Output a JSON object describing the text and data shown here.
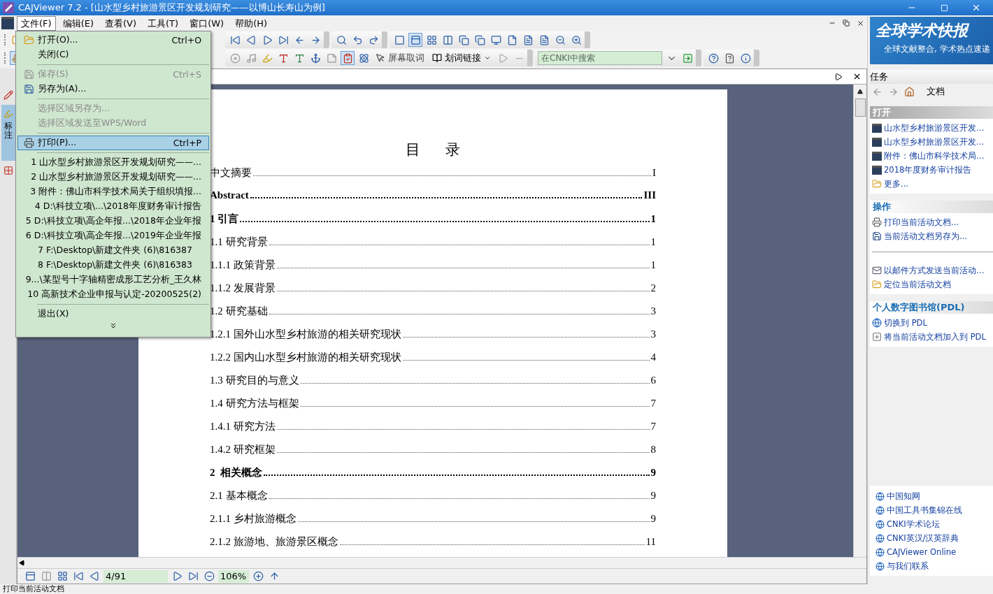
{
  "window": {
    "title": "CAJViewer 7.2 - [山水型乡村旅游景区开发规划研究——以博山长寿山为例]"
  },
  "menu_bar": [
    {
      "label": "文件(F)",
      "selected": true
    },
    {
      "label": "编辑(E)",
      "selected": false
    },
    {
      "label": "查看(V)",
      "selected": false
    },
    {
      "label": "工具(T)",
      "selected": false
    },
    {
      "label": "窗口(W)",
      "selected": false
    },
    {
      "label": "帮助(H)",
      "selected": false
    }
  ],
  "file_menu": [
    {
      "kind": "command",
      "label": "打开(O)...",
      "shortcut": "Ctrl+O",
      "disabled": false,
      "selected": false
    },
    {
      "kind": "command",
      "label": "关闭(C)",
      "disabled": false,
      "selected": false
    },
    {
      "kind": "separator"
    },
    {
      "kind": "command",
      "label": "保存(S)",
      "shortcut": "Ctrl+S",
      "disabled": true,
      "selected": false
    },
    {
      "kind": "command",
      "label": "另存为(A)...",
      "disabled": false,
      "selected": false
    },
    {
      "kind": "separator"
    },
    {
      "kind": "command",
      "label": "选择区域另存为...",
      "disabled": true,
      "selected": false
    },
    {
      "kind": "command",
      "label": "选择区域发送至WPS/Word",
      "disabled": true,
      "selected": false
    },
    {
      "kind": "separator"
    },
    {
      "kind": "command",
      "label": "打印(P)...",
      "shortcut": "Ctrl+P",
      "disabled": false,
      "selected": true
    },
    {
      "kind": "separator"
    },
    {
      "kind": "command",
      "label": "1 山水型乡村旅游景区开发规划研究——...",
      "disabled": false,
      "selected": false
    },
    {
      "kind": "command",
      "label": "2 山水型乡村旅游景区开发规划研究——...",
      "disabled": false,
      "selected": false
    },
    {
      "kind": "command",
      "label": "3 附件：佛山市科学技术局关于组织填报...",
      "disabled": false,
      "selected": false
    },
    {
      "kind": "command",
      "label": "4 D:\\科技立项\\...\\2018年度财务审计报告",
      "disabled": false,
      "selected": false
    },
    {
      "kind": "command",
      "label": "5 D:\\科技立项\\高企年报...\\2018年企业年报",
      "disabled": false,
      "selected": false
    },
    {
      "kind": "command",
      "label": "6 D:\\科技立项\\高企年报...\\2019年企业年报",
      "disabled": false,
      "selected": false
    },
    {
      "kind": "command",
      "label": "7 F:\\Desktop\\新建文件夹 (6)\\816387",
      "disabled": false,
      "selected": false
    },
    {
      "kind": "command",
      "label": "8 F:\\Desktop\\新建文件夹 (6)\\816383",
      "disabled": false,
      "selected": false
    },
    {
      "kind": "command",
      "label": "9...\\某型号十字轴精密成形工艺分析_王久林",
      "disabled": false,
      "selected": false
    },
    {
      "kind": "command",
      "label": "10 高新技术企业申报与认定-20200525(2)",
      "disabled": false,
      "selected": false
    },
    {
      "kind": "separator"
    },
    {
      "kind": "command",
      "label": "退出(X)",
      "disabled": false,
      "selected": false
    },
    {
      "kind": "more"
    }
  ],
  "toolbar": {
    "screen_word_button": "屏幕取词",
    "link_button": "划词链接",
    "search": {
      "placeholder": "在CNKI中搜索"
    }
  },
  "side_tab": {
    "label": "标注"
  },
  "document": {
    "title": "目 录",
    "entries": [
      {
        "label": "中文摘要",
        "page": "I",
        "bold": false
      },
      {
        "label": "Abstract",
        "page": "III",
        "bold": true
      },
      {
        "label": "1 引言",
        "page": "1",
        "bold": true
      },
      {
        "label": "1.1 研究背景",
        "page": "1",
        "bold": false
      },
      {
        "label": "1.1.1 政策背景",
        "page": "1",
        "bold": false
      },
      {
        "label": "1.1.2 发展背景",
        "page": "2",
        "bold": false
      },
      {
        "label": "1.2 研究基础",
        "page": "3",
        "bold": false
      },
      {
        "label": "1.2.1 国外山水型乡村旅游的相关研究现状",
        "page": "3",
        "bold": false
      },
      {
        "label": "1.2.2 国内山水型乡村旅游的相关研究现状",
        "page": "4",
        "bold": false
      },
      {
        "label": "1.3 研究目的与意义",
        "page": "6",
        "bold": false
      },
      {
        "label": "1.4 研究方法与框架",
        "page": "7",
        "bold": false
      },
      {
        "label": "1.4.1 研究方法",
        "page": "7",
        "bold": false
      },
      {
        "label": "1.4.2 研究框架",
        "page": "8",
        "bold": false
      },
      {
        "label": "2  相关概念",
        "page": "9",
        "bold": true
      },
      {
        "label": "2.1 基本概念",
        "page": "9",
        "bold": false
      },
      {
        "label": "2.1.1 乡村旅游概念",
        "page": "9",
        "bold": false
      },
      {
        "label": "2.1.2 旅游地、旅游景区概念",
        "page": "11",
        "bold": false
      }
    ]
  },
  "navigation": {
    "page_field": "4/91",
    "zoom_field": "106%"
  },
  "banner": {
    "title": "全球学术快报",
    "subtitle": "全球文献整合, 学术热点速递"
  },
  "task_panel": {
    "title": "任务",
    "nav_label": "文档",
    "sections": [
      {
        "title": "打开",
        "items": [
          {
            "kind": "pdf",
            "label": "山水型乡村旅游景区开发…"
          },
          {
            "kind": "pdf",
            "label": "山水型乡村旅游景区开发…"
          },
          {
            "kind": "pdf",
            "label": "附件：佛山市科学技术局…"
          },
          {
            "kind": "pdf",
            "label": "2018年度财务审计报告"
          },
          {
            "kind": "folder",
            "label": "更多..."
          }
        ]
      },
      {
        "title": "操作",
        "items": [
          {
            "kind": "print",
            "label": "打印当前活动文档..."
          },
          {
            "kind": "save",
            "label": "当前活动文档另存为..."
          },
          {
            "kind": "separator"
          },
          {
            "kind": "mail",
            "label": "以邮件方式发送当前活动…"
          },
          {
            "kind": "folder",
            "label": "定位当前活动文档"
          }
        ]
      },
      {
        "title": "个人数字图书馆(PDL)",
        "items": [
          {
            "kind": "globe",
            "label": "切换到 PDL"
          },
          {
            "kind": "add",
            "label": "将当前活动文档加入到 PDL"
          }
        ]
      }
    ],
    "links": [
      "中国知网",
      "中国工具书集锦在线",
      "CNKI学术论坛",
      "CNKI英汉/汉英辞典",
      "CAJViewer Online",
      "与我们联系"
    ]
  },
  "status_bar": {
    "text": "打印当前活动文档"
  }
}
